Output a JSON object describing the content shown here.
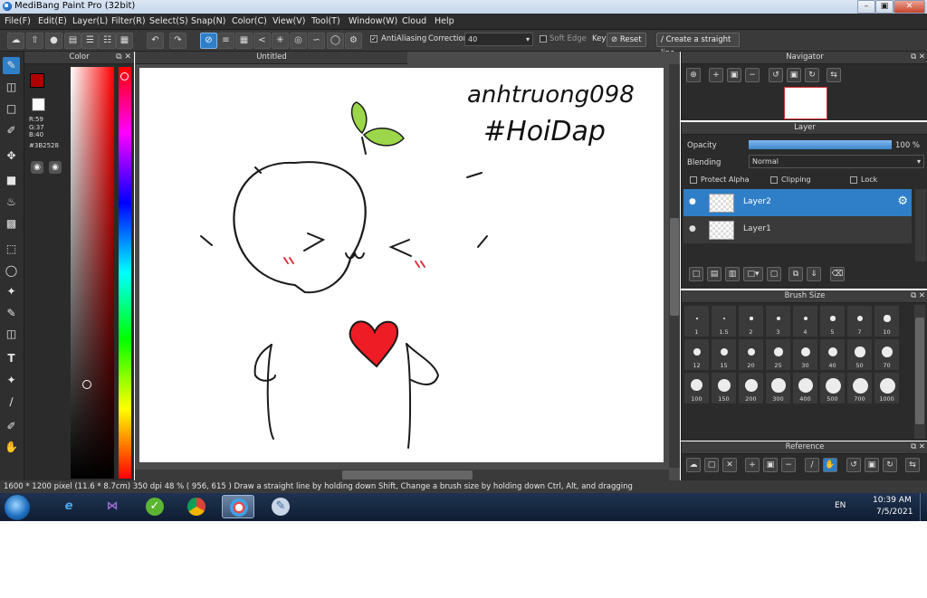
{
  "window": {
    "title": "MediBang Paint Pro (32bit)"
  },
  "menu": [
    "File(F)",
    "Edit(E)",
    "Layer(L)",
    "Filter(R)",
    "Select(S)",
    "Snap(N)",
    "Color(C)",
    "View(V)",
    "Tool(T)",
    "Window(W)",
    "Cloud",
    "Help"
  ],
  "toolbar": {
    "antialiasing_label": "AntiAliasing",
    "correction_label": "Correction",
    "correction_value": "40",
    "soft_edge_label": "Soft Edge",
    "key_label": "Key",
    "reset_label": "Reset",
    "straight_line_label": "Create a straight line"
  },
  "color_panel": {
    "title": "Color",
    "r": "R:59",
    "g": "G:37",
    "b": "B:40",
    "hex": "#3B2528",
    "primary_color": "#b00000",
    "secondary_color": "#ffffff"
  },
  "canvas": {
    "tab_title": "Untitled",
    "drawing_text_1": "anhtruong098",
    "drawing_text_2": "#HoiDap"
  },
  "navigator": {
    "title": "Navigator"
  },
  "layer_panel": {
    "title": "Layer",
    "opacity_label": "Opacity",
    "opacity_value": "100 %",
    "opacity_fraction": 1.0,
    "blending_label": "Blending",
    "blending_value": "Normal",
    "protect_alpha_label": "Protect Alpha",
    "clipping_label": "Clipping",
    "lock_label": "Lock",
    "layers": [
      {
        "name": "Layer2",
        "selected": true
      },
      {
        "name": "Layer1",
        "selected": false
      }
    ]
  },
  "brush_size_panel": {
    "title": "Brush Size",
    "sizes": [
      "1",
      "1.5",
      "2",
      "3",
      "4",
      "5",
      "7",
      "10",
      "12",
      "15",
      "20",
      "25",
      "30",
      "40",
      "50",
      "70",
      "100",
      "150",
      "200",
      "300",
      "400",
      "500",
      "700",
      "1000"
    ]
  },
  "reference_panel": {
    "title": "Reference"
  },
  "status_bar": {
    "text": "1600 * 1200 pixel   (11.6 * 8.7cm)  350 dpi  48 %  ( 956, 615 )  Draw a straight line by holding down Shift, Change a brush size by holding down Ctrl, Alt, and dragging"
  },
  "taskbar": {
    "language": "EN",
    "time": "10:39 AM",
    "date": "7/5/2021"
  },
  "colors": {
    "accent": "#2f7fc8",
    "panel_bg": "#2b2b2b"
  }
}
